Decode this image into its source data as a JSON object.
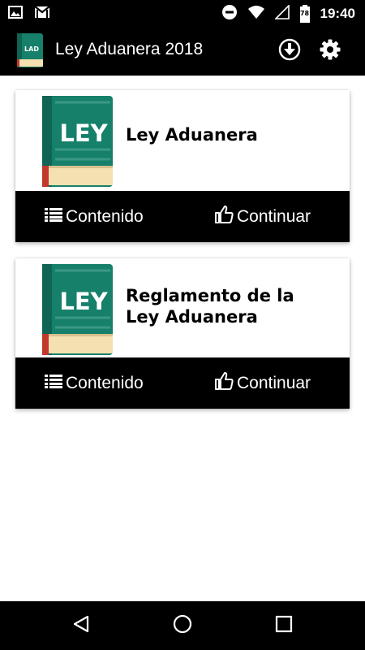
{
  "status_bar": {
    "time": "19:40",
    "battery_level": "78",
    "icons": [
      "image-icon",
      "gmail-icon",
      "do-not-disturb-icon",
      "wifi-icon",
      "signal-icon",
      "battery-icon"
    ]
  },
  "app_bar": {
    "title": "Ley Aduanera 2018",
    "logo_text": "LAD",
    "actions": [
      "download-icon",
      "settings-icon"
    ]
  },
  "cards": [
    {
      "cover_text": "LEY",
      "title": "Ley Aduanera",
      "contents_label": "Contenido",
      "continue_label": "Continuar"
    },
    {
      "cover_text": "LEY",
      "title": "Reglamento de la\nLey Aduanera",
      "contents_label": "Contenido",
      "continue_label": "Continuar"
    }
  ],
  "nav_bar": {
    "buttons": [
      "back-icon",
      "home-icon",
      "recents-icon"
    ]
  },
  "colors": {
    "bar_background": "#000000",
    "book_green": "#16806a",
    "book_pages": "#f4e0b0",
    "book_spine_red": "#c0392b"
  }
}
